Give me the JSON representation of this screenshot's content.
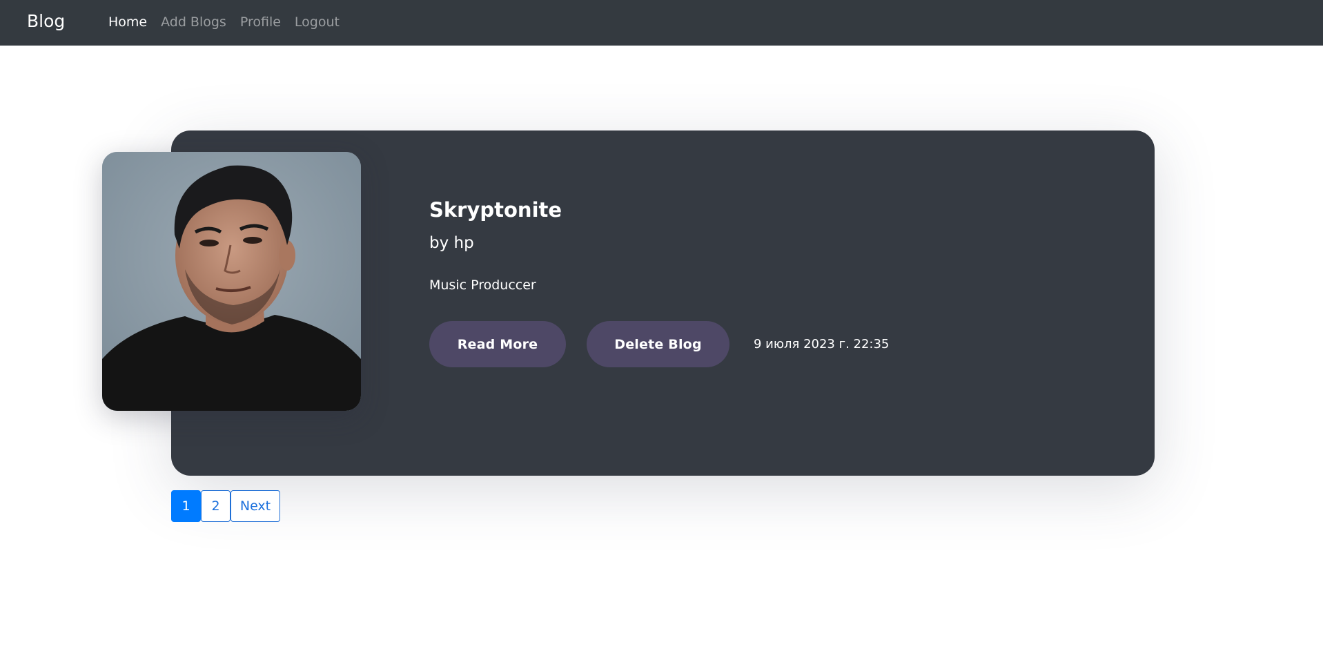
{
  "nav": {
    "brand": "Blog",
    "links": [
      {
        "label": "Home",
        "active": true
      },
      {
        "label": "Add Blogs",
        "active": false
      },
      {
        "label": "Profile",
        "active": false
      },
      {
        "label": "Logout",
        "active": false
      }
    ]
  },
  "post": {
    "title": "Skryptonite",
    "author": "by hp",
    "description": "Music Produccer",
    "read_more_label": "Read More",
    "delete_label": "Delete Blog",
    "date": "9 июля 2023 г. 22:35"
  },
  "pagination": {
    "pages": [
      "1",
      "2"
    ],
    "active_page": "1",
    "next_label": "Next"
  },
  "colors": {
    "navbar": "#343a40",
    "card": "#353a42",
    "button": "#4e4866",
    "page_active": "#007bff"
  }
}
